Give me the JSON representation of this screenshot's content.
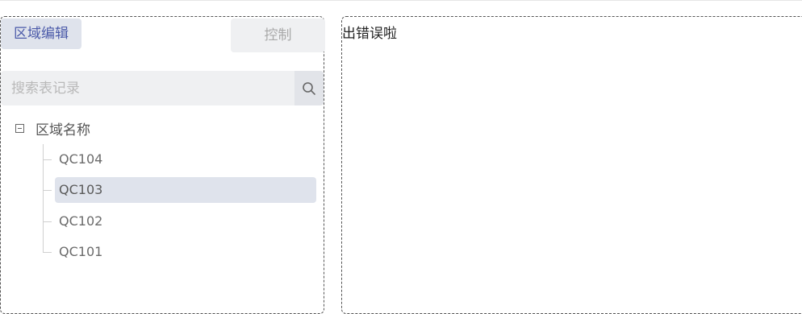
{
  "tabs": {
    "active_label": "区域编辑",
    "inactive_label": "控制"
  },
  "search": {
    "placeholder": "搜索表记录",
    "value": ""
  },
  "tree": {
    "root_label": "区域名称",
    "nodes": [
      {
        "label": "QC104",
        "selected": false
      },
      {
        "label": "QC103",
        "selected": true
      },
      {
        "label": "QC102",
        "selected": false
      },
      {
        "label": "QC101",
        "selected": false
      }
    ]
  },
  "main": {
    "error_message": "出错误啦"
  },
  "colors": {
    "accent": "#4b5aa9",
    "selected_bg": "#dfe3ec",
    "panel_bg": "#eff0f2"
  },
  "icons": {
    "search": "search-icon",
    "collapse": "minus-square-icon"
  }
}
